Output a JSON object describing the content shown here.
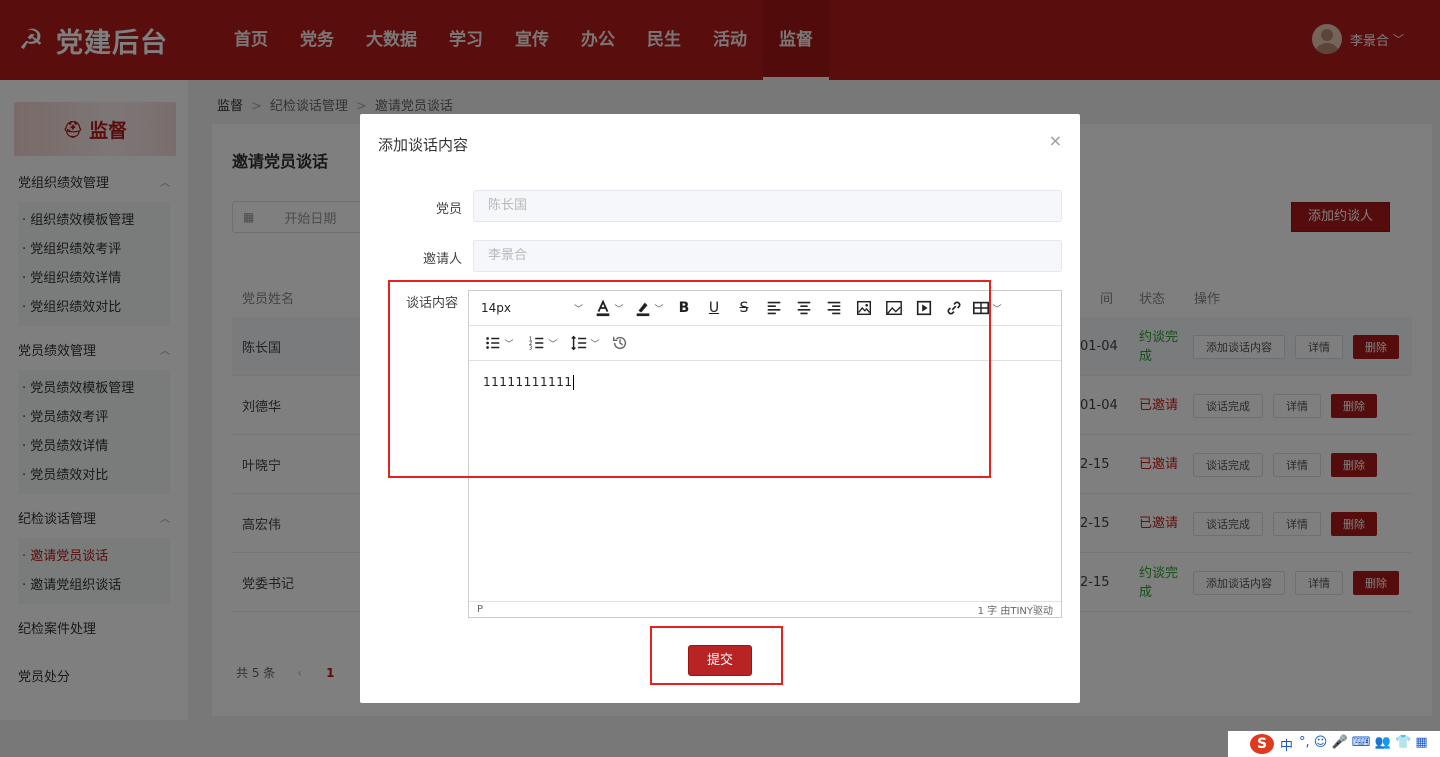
{
  "app": {
    "title": "党建后台",
    "logo_icon": "party-emblem-icon"
  },
  "nav": [
    "首页",
    "党务",
    "大数据",
    "学习",
    "宣传",
    "办公",
    "民生",
    "活动",
    "监督"
  ],
  "nav_active": "监督",
  "user": {
    "name": "李景合",
    "dropdown_icon": "chevron-down-icon"
  },
  "sidebar": {
    "banner": "监督",
    "groups": [
      {
        "title": "党组织绩效管理",
        "items": [
          "· 组织绩效模板管理",
          "· 党组织绩效考评",
          "· 党组织绩效详情",
          "· 党组织绩效对比"
        ]
      },
      {
        "title": "党员绩效管理",
        "items": [
          "· 党员绩效模板管理",
          "· 党员绩效考评",
          "· 党员绩效详情",
          "· 党员绩效对比"
        ]
      },
      {
        "title": "纪检谈话管理",
        "items": [
          "· 邀请党员谈话",
          "· 邀请党组织谈话"
        ]
      },
      {
        "title": "纪检案件处理",
        "items": []
      },
      {
        "title": "党员处分",
        "items": []
      }
    ],
    "active_item": "· 邀请党员谈话"
  },
  "breadcrumb": [
    "监督",
    "纪检谈话管理",
    "邀请党员谈话"
  ],
  "main": {
    "title": "邀请党员谈话",
    "date_placeholder": "开始日期",
    "add_button": "添加约谈人",
    "columns": {
      "name": "党员姓名",
      "time": "间",
      "status": "状态",
      "ops": "操作"
    },
    "rows": [
      {
        "name": "陈长国",
        "date": "01-04",
        "status": "约谈完成",
        "status_color": "#2e9c2e",
        "op1": "添加谈话内容",
        "op2": "详情",
        "op3": "删除"
      },
      {
        "name": "刘德华",
        "date": "01-04",
        "status": "已邀请",
        "status_color": "#c81e1e",
        "op1": "谈话完成",
        "op2": "详情",
        "op3": "删除"
      },
      {
        "name": "叶晓宁",
        "date": "2-15",
        "status": "已邀请",
        "status_color": "#c81e1e",
        "op1": "谈话完成",
        "op2": "详情",
        "op3": "删除"
      },
      {
        "name": "高宏伟",
        "date": "2-15",
        "status": "已邀请",
        "status_color": "#c81e1e",
        "op1": "谈话完成",
        "op2": "详情",
        "op3": "删除"
      },
      {
        "name": "党委书记",
        "date": "2-15",
        "status": "约谈完成",
        "status_color": "#2e9c2e",
        "op1": "添加谈话内容",
        "op2": "详情",
        "op3": "删除"
      }
    ],
    "pager": {
      "total": "共 5 条",
      "current": "1"
    }
  },
  "dialog": {
    "title": "添加谈话内容",
    "close": "×",
    "member_label": "党员",
    "member_value": "陈长国",
    "inviter_label": "邀请人",
    "inviter_value": "李景合",
    "content_label": "谈话内容",
    "font_size": "14px",
    "content": "11111111111",
    "status_path": "P",
    "status_right": "1 字  由TINY驱动",
    "submit": "提交"
  },
  "ime": {
    "logo": "S",
    "lang": "中",
    "items": "°, ☺ 🎤 ⌨ 👥 👕 ▦"
  },
  "colors": {
    "brand": "#b31b1b",
    "highlight": "#e52222"
  }
}
